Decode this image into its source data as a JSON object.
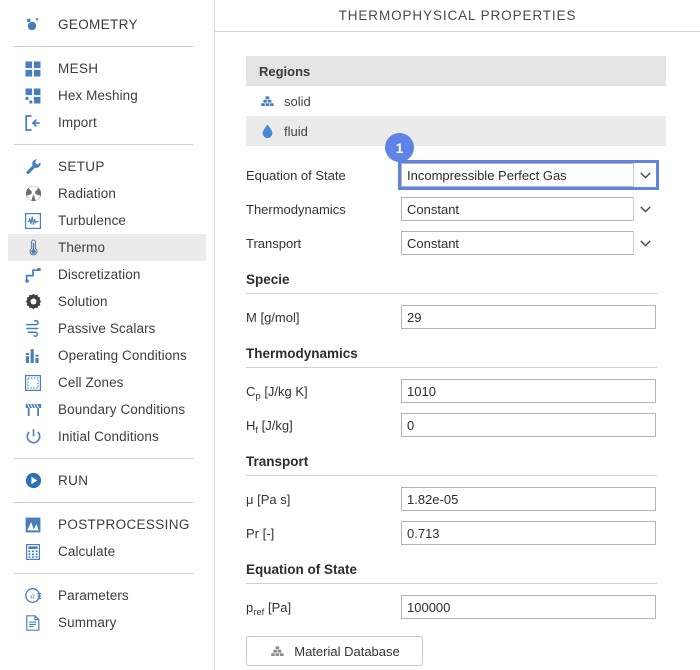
{
  "sidebar": {
    "groups": [
      {
        "items": [
          {
            "label": "GEOMETRY",
            "icon": "geometry-icon",
            "kind": "section",
            "selected": false
          }
        ]
      },
      {
        "items": [
          {
            "label": "MESH",
            "icon": "mesh-icon",
            "kind": "section",
            "selected": false
          },
          {
            "label": "Hex Meshing",
            "icon": "hex-meshing-icon",
            "kind": "item",
            "selected": false
          },
          {
            "label": "Import",
            "icon": "import-icon",
            "kind": "item",
            "selected": false
          }
        ]
      },
      {
        "items": [
          {
            "label": "SETUP",
            "icon": "wrench-icon",
            "kind": "section",
            "selected": false
          },
          {
            "label": "Radiation",
            "icon": "radiation-icon",
            "kind": "item",
            "selected": false
          },
          {
            "label": "Turbulence",
            "icon": "turbulence-icon",
            "kind": "item",
            "selected": false
          },
          {
            "label": "Thermo",
            "icon": "thermometer-icon",
            "kind": "item",
            "selected": true
          },
          {
            "label": "Discretization",
            "icon": "discretization-icon",
            "kind": "item",
            "selected": false
          },
          {
            "label": "Solution",
            "icon": "gear-icon",
            "kind": "item",
            "selected": false
          },
          {
            "label": "Passive Scalars",
            "icon": "passive-scalars-icon",
            "kind": "item",
            "selected": false
          },
          {
            "label": "Operating Conditions",
            "icon": "bar-chart-icon",
            "kind": "item",
            "selected": false
          },
          {
            "label": "Cell Zones",
            "icon": "cell-zones-icon",
            "kind": "item",
            "selected": false
          },
          {
            "label": "Boundary Conditions",
            "icon": "boundary-conditions-icon",
            "kind": "item",
            "selected": false
          },
          {
            "label": "Initial Conditions",
            "icon": "power-icon",
            "kind": "item",
            "selected": false
          }
        ]
      },
      {
        "items": [
          {
            "label": "RUN",
            "icon": "play-icon",
            "kind": "section",
            "selected": false
          }
        ]
      },
      {
        "items": [
          {
            "label": "POSTPROCESSING",
            "icon": "postprocessing-icon",
            "kind": "section",
            "selected": false
          },
          {
            "label": "Calculate",
            "icon": "calculator-icon",
            "kind": "item",
            "selected": false
          }
        ]
      },
      {
        "items": [
          {
            "label": "Parameters",
            "icon": "parameters-icon",
            "kind": "item",
            "selected": false
          },
          {
            "label": "Summary",
            "icon": "summary-icon",
            "kind": "item",
            "selected": false
          }
        ]
      }
    ]
  },
  "main": {
    "title": "THERMOPHYSICAL PROPERTIES",
    "regions": {
      "header": "Regions",
      "rows": [
        {
          "label": "solid",
          "icon": "solid-icon"
        },
        {
          "label": "fluid",
          "icon": "fluid-drop-icon"
        }
      ]
    },
    "selects": [
      {
        "label": "Equation of State",
        "value": "Incompressible Perfect Gas",
        "highlighted": true
      },
      {
        "label": "Thermodynamics",
        "value": "Constant",
        "highlighted": false
      },
      {
        "label": "Transport",
        "value": "Constant",
        "highlighted": false
      }
    ],
    "sections": [
      {
        "title": "Specie",
        "fields": [
          {
            "label_main": "M",
            "label_sub": "",
            "label_unit": "[g/mol]",
            "value": "29"
          }
        ]
      },
      {
        "title": "Thermodynamics",
        "fields": [
          {
            "label_main": "C",
            "label_sub": "p",
            "label_unit": "[J/kg K]",
            "value": "1010"
          },
          {
            "label_main": "H",
            "label_sub": "f",
            "label_unit": "[J/kg]",
            "value": "0"
          }
        ]
      },
      {
        "title": "Transport",
        "fields": [
          {
            "label_main": "μ",
            "label_sub": "",
            "label_unit": "[Pa s]",
            "value": "1.82e-05"
          },
          {
            "label_main": "Pr",
            "label_sub": "",
            "label_unit": "[-]",
            "value": "0.713"
          }
        ]
      },
      {
        "title": "Equation of State",
        "fields": [
          {
            "label_main": "p",
            "label_sub": "ref",
            "label_unit": "[Pa]",
            "value": "100000"
          }
        ]
      }
    ],
    "material_database_button": "Material Database"
  },
  "annotation": {
    "badge_number": "1",
    "badge_color": "#5f84e8"
  },
  "colors": {
    "accent_blue": "#4a7ebb",
    "highlight_outline": "#5f84e8",
    "selected_row": "#ebebeb",
    "table_header": "#e4e4e4"
  }
}
